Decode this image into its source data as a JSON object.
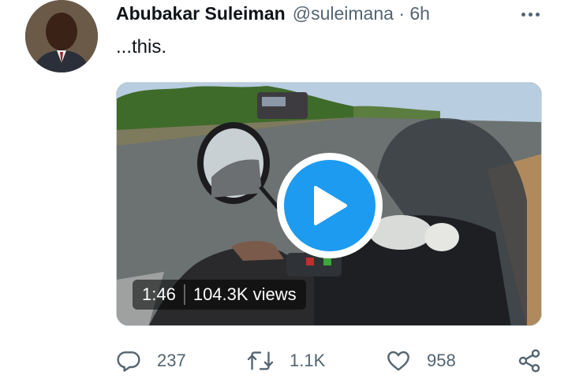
{
  "tweet": {
    "display_name": "Abubakar Suleiman",
    "handle": "@suleimana",
    "time": "· 6h",
    "text": "...this."
  },
  "media": {
    "duration": "1:46",
    "views": "104.3K views"
  },
  "actions": {
    "replies": "237",
    "retweets": "1.1K",
    "likes": "958"
  },
  "icons": {
    "more": "more-icon",
    "reply": "reply-icon",
    "retweet": "retweet-icon",
    "like": "heart-icon",
    "share": "share-icon",
    "play": "play-icon"
  },
  "colors": {
    "accent": "#1d9bf0",
    "secondary_text": "#536471"
  }
}
